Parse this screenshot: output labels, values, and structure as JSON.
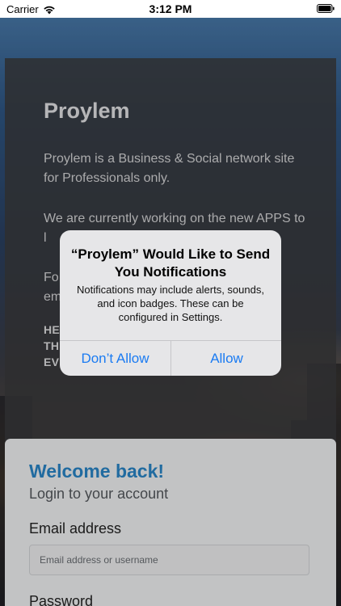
{
  "status_bar": {
    "carrier": "Carrier",
    "time": "3:12 PM",
    "wifi_icon": "wifi-icon",
    "battery_icon": "battery-full-icon"
  },
  "info": {
    "title": "Proylem",
    "paragraph1": "Proylem is a Business & Social network site for Professionals only.",
    "paragraph2": "We are currently working on the new APPS to l",
    "paragraph3a": "Fo",
    "paragraph3b": "em",
    "caps_line1": "HE",
    "caps_line2": "TH",
    "caps_line3": "EV"
  },
  "alert": {
    "title": "“Proylem” Would Like to Send You Notifications",
    "message": "Notifications may include alerts, sounds, and icon badges. These can be configured in Settings.",
    "deny_label": "Don’t Allow",
    "allow_label": "Allow",
    "button_color": "#1a7bf2"
  },
  "login": {
    "welcome": "Welcome back!",
    "subtitle": "Login to your account",
    "email_label": "Email address",
    "email_placeholder": "Email address or username",
    "email_value": "",
    "password_label": "Password",
    "accent_color": "#2a86c8"
  }
}
